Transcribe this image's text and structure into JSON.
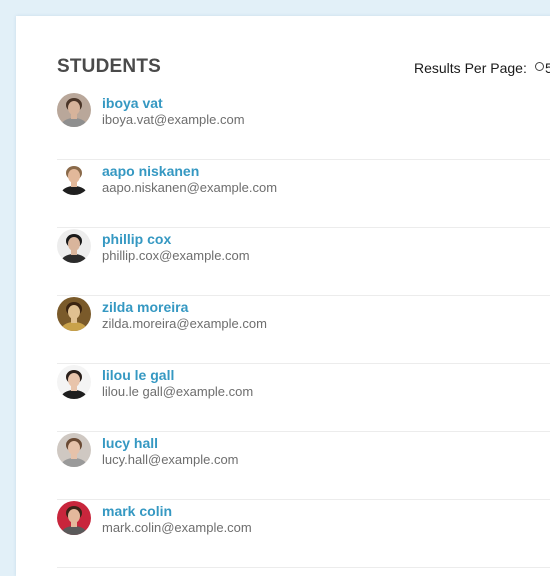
{
  "header": {
    "title": "STUDENTS",
    "results_per_page_label": "Results Per Page:",
    "results_per_page_option": "5"
  },
  "students": [
    {
      "name": "iboya vat",
      "email": "iboya.vat@example.com",
      "avatar_colors": {
        "bg": "#b9a79a",
        "hair": "#4a3528",
        "skin": "#d6b39b",
        "shirt": "#8f8f8f"
      }
    },
    {
      "name": "aapo niskanen",
      "email": "aapo.niskanen@example.com",
      "avatar_colors": {
        "bg": "#ffffff",
        "hair": "#8a6a4a",
        "skin": "#e2b89a",
        "shirt": "#1f1f1f"
      }
    },
    {
      "name": "phillip cox",
      "email": "phillip.cox@example.com",
      "avatar_colors": {
        "bg": "#ededed",
        "hair": "#1a1a1a",
        "skin": "#d9b59c",
        "shirt": "#2b2b2b"
      }
    },
    {
      "name": "zilda moreira",
      "email": "zilda.moreira@example.com",
      "avatar_colors": {
        "bg": "#7a5a2a",
        "hair": "#3b2410",
        "skin": "#e0c090",
        "shirt": "#c9a24a"
      }
    },
    {
      "name": "lilou le gall",
      "email": "lilou.le gall@example.com",
      "avatar_colors": {
        "bg": "#f4f4f4",
        "hair": "#2a1f1a",
        "skin": "#e8c4ab",
        "shirt": "#1e1e1e"
      }
    },
    {
      "name": "lucy hall",
      "email": "lucy.hall@example.com",
      "avatar_colors": {
        "bg": "#cfc8c2",
        "hair": "#6a4a34",
        "skin": "#e6c2aa",
        "shirt": "#9a9a9a"
      }
    },
    {
      "name": "mark colin",
      "email": "mark.colin@example.com",
      "avatar_colors": {
        "bg": "#c8263c",
        "hair": "#3a2418",
        "skin": "#e4b89c",
        "shirt": "#5a5a5a"
      }
    }
  ]
}
